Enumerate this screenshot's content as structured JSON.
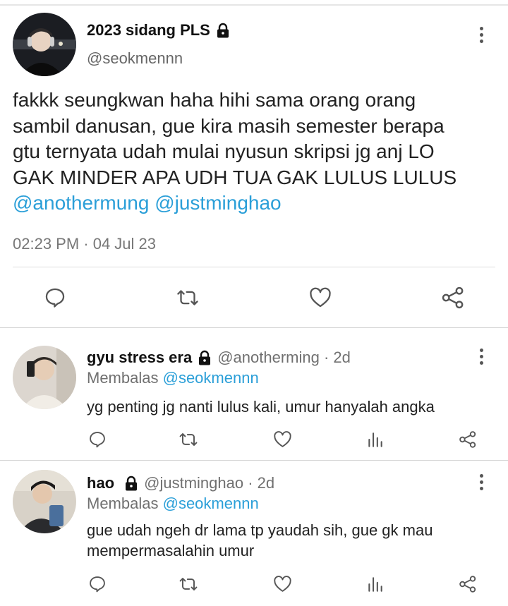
{
  "main_tweet": {
    "display_name": "2023 sidang PLS",
    "handle": "@seokmennn",
    "text_lines": [
      "fakkk seungkwan haha hihi sama orang orang",
      "sambil danusan, gue kira masih semester berapa",
      "gtu ternyata udah mulai nyusun skripsi jg anj LO",
      "GAK MINDER APA UDH TUA GAK LULUS LULUS"
    ],
    "mention_1": "@anothermung",
    "mention_2": "@justminghao",
    "timestamp": "02:23 PM · 04 Jul 23"
  },
  "replies": [
    {
      "display_name": "gyu stress era",
      "handle": "@anotherming · 2d",
      "replying_label": "Membalas",
      "replying_to": "@seokmennn",
      "text": "yg penting jg nanti lulus kali, umur hanyalah angka"
    },
    {
      "display_name": "hao",
      "handle": "@justminghao · 2d",
      "replying_label": "Membalas",
      "replying_to": "@seokmennn",
      "text": "gue udah ngeh dr lama tp yaudah sih, gue gk mau mempermasalahin umur"
    }
  ],
  "icons": {
    "lock": "lock-icon",
    "more": "more-vertical-icon",
    "reply": "comment-icon",
    "retweet": "retweet-icon",
    "like": "heart-icon",
    "share": "share-icon",
    "analytics": "bar-chart-icon"
  },
  "colors": {
    "link": "#2b9fd8",
    "icon": "#555555",
    "secondary_text": "#707070"
  }
}
